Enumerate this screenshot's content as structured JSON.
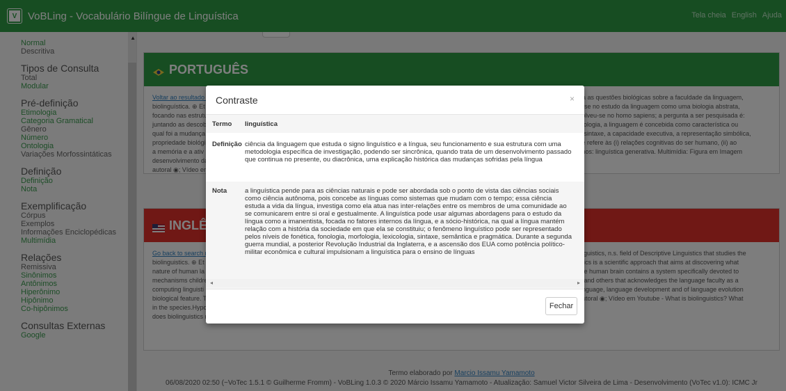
{
  "app": {
    "title": "VoBLing - Vocabulário Bilíngue de Linguística",
    "nav_links": [
      "Tela cheia",
      "English",
      "Ajuda"
    ]
  },
  "sidebar": {
    "items": [
      {
        "type": "item",
        "label": "Normal",
        "link": true
      },
      {
        "type": "item",
        "label": "Descritiva",
        "link": false
      },
      {
        "type": "head",
        "label": "Tipos de Consulta"
      },
      {
        "type": "item",
        "label": "Total",
        "link": false
      },
      {
        "type": "item",
        "label": "Modular",
        "link": true
      },
      {
        "type": "head",
        "label": "Pré-definição"
      },
      {
        "type": "item",
        "label": "Etimologia",
        "link": true
      },
      {
        "type": "item",
        "label": "Categoria Gramatical",
        "link": true
      },
      {
        "type": "item",
        "label": "Gênero",
        "link": false
      },
      {
        "type": "item",
        "label": "Número",
        "link": true
      },
      {
        "type": "item",
        "label": "Ontologia",
        "link": true
      },
      {
        "type": "item",
        "label": "Variações Morfossintáticas",
        "link": false
      },
      {
        "type": "head",
        "label": "Definição"
      },
      {
        "type": "item",
        "label": "Definição",
        "link": true
      },
      {
        "type": "item",
        "label": "Nota",
        "link": true
      },
      {
        "type": "head",
        "label": "Exemplificação"
      },
      {
        "type": "item",
        "label": "Córpus",
        "link": false
      },
      {
        "type": "item",
        "label": "Exemplos",
        "link": false
      },
      {
        "type": "item",
        "label": "Informações Enciclopédicas",
        "link": false
      },
      {
        "type": "item",
        "label": "Multimídia",
        "link": true
      },
      {
        "type": "head",
        "label": "Relações"
      },
      {
        "type": "item",
        "label": "Remissiva",
        "link": false
      },
      {
        "type": "item",
        "label": "Sinônimos",
        "link": true
      },
      {
        "type": "item",
        "label": "Antônimos",
        "link": true
      },
      {
        "type": "item",
        "label": "Hiperônimo",
        "link": true
      },
      {
        "type": "item",
        "label": "Hipônimo",
        "link": true
      },
      {
        "type": "item",
        "label": "Co-hipônimos",
        "link": true
      },
      {
        "type": "head",
        "label": "Consultas Externas"
      },
      {
        "type": "item",
        "label": "Google",
        "link": true
      }
    ]
  },
  "panels": {
    "pt": {
      "heading": "PORTUGUÊS",
      "back_link": "Voltar ao resultado d",
      "left_lines": [
        "biolinguística. ⊕ Et",
        "focando nas estrutu",
        "juntando as descob",
        "qual foi a mudança",
        "propriedade biológi",
        "a memória e a ativ",
        "desenvolvimento da",
        "autoral ◉; Vídeo em"
      ],
      "right_lines": [
        "da as questões biológicas sobre a faculdade da linguagem,",
        "a-se no estudo da linguagem como uma biologia abstrata,",
        "volveu-se no homo sapiens; a pergunta a ser pesquisada é:",
        "biologia, a linguagem é concebida como característica ou",
        "a sintaxe, a capacidade executiva, a representação simbólica,",
        "se refere às (i) relações cognitivas do ser humano, (ii) ao",
        "imos: linguística generativa. Multimídia: Figura em Imagem"
      ]
    },
    "en": {
      "heading": "INGLÊS",
      "back_link": "Go back to search re",
      "left_lines": [
        "biolinguistics. ⊕ Et",
        "nature of human la",
        "mechanisms childre",
        "computing linguisti",
        "biological feature. T",
        "in the species.Hypo",
        "does biolinguistics mean? ▣."
      ],
      "right_lines": [
        "inguistics, n.s. field of Descriptive Linguistics that studies the",
        "stics is a scientific approach that aims at discovering what",
        "the human brain contains a system specifically devoted to",
        "r, and others that acknowledges the language faculty as a",
        "anguage, language development and of language evolution",
        "autoral ◉; Vídeo em Youtube - What is biolinguistics? What"
      ]
    }
  },
  "footer": {
    "line1_prefix": "Termo elaborado por ",
    "line1_author": "Marcio Issamu Yamamoto",
    "line2": "06/08/2020 02:50 (~VoTec 1.5.1 © Guilherme Fromm) - VoBLing 1.0.3 © 2020 Márcio Issamu Yamamoto - Atualização: Samuel Victor Silveira de Lima - Desenvolvimento (VoTec v1.0): ICMC Jr"
  },
  "modal": {
    "title": "Contraste",
    "close_symbol": "×",
    "term_label": "Termo",
    "term_value": "linguística",
    "definition_label": "Definição",
    "definition_value": "ciência da linguagem que estuda o signo linguístico e a língua, seu funcionamento e sua estrutura com uma metodologia específica de investigação, podendo ser sincrônica, quando trata de um desenvolvimento passado que continua no presente, ou diacrônica, uma explicação histórica das mudanças sofridas pela língua",
    "note_label": "Nota",
    "note_value": "a linguística pende para as ciências naturais e pode ser abordada sob o ponto de vista das ciências sociais como ciência autônoma, pois concebe as línguas como sistemas que mudam com o tempo; essa ciência estuda a vida da língua, investiga como ela atua nas inter-relações entre os membros de uma comunidade ao se comunicarem entre si oral e gestualmente. A linguística pode usar algumas abordagens para o estudo da língua como a imanentista, focada no fatores internos da língua, e a sócio-histórica, na qual a língua mantém relação com a história da sociedade em que ela se constituiu; o fenômeno linguístico pode ser representado pelos níveis de fonética, fonologia, morfologia, lexicologia, sintaxe, semântica e pragmática. Durante a segunda guerra mundial, a posterior Revolução Industrial da Inglaterra, e a ascensão dos EUA como potência político-militar econômica e cultural impulsionam a linguística para o ensino de línguas",
    "close_button": "Fechar"
  }
}
